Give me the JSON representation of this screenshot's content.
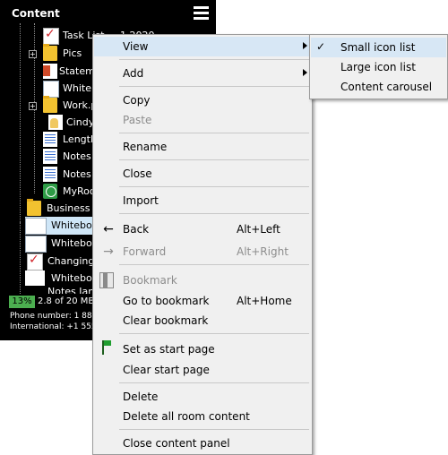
{
  "panel": {
    "title": "Content",
    "tree": [
      {
        "label": "Task List ... 1 2020",
        "icon": "checklist-icon"
      },
      {
        "label": "Pics",
        "icon": "folder-icon"
      },
      {
        "label": "Statem",
        "icon": "presentation-icon"
      },
      {
        "label": "Whiteb",
        "icon": "whiteboard-icon"
      },
      {
        "label": "Work.p",
        "icon": "folder-icon"
      },
      {
        "label": "Cindy",
        "icon": "person-icon"
      },
      {
        "label": "Length",
        "icon": "document-icon"
      },
      {
        "label": "Notes",
        "icon": "notes-icon"
      },
      {
        "label": "Notes",
        "icon": "notes-icon"
      },
      {
        "label": "MyRoo",
        "icon": "globe-icon"
      },
      {
        "label": "Business",
        "icon": "folder-icon"
      },
      {
        "label": "Whitebo",
        "icon": "whiteboard-icon"
      },
      {
        "label": "Whitebo",
        "icon": "whiteboard-icon"
      },
      {
        "label": "Changing",
        "icon": "checklist-icon"
      },
      {
        "label": "Whitebo",
        "icon": "whiteboard-icon"
      },
      {
        "label": "Notes Jan",
        "icon": "notes-icon"
      }
    ],
    "usage_percent_label": "13%",
    "usage_percent": 13,
    "usage_size": "2.8 of 20 MB",
    "phone": "Phone number: 1 888",
    "international": "International:  +1 555"
  },
  "menu": {
    "view": "View",
    "add": "Add",
    "copy": "Copy",
    "paste": "Paste",
    "rename": "Rename",
    "close": "Close",
    "import": "Import",
    "back": "Back",
    "back_shortcut": "Alt+Left",
    "forward": "Forward",
    "forward_shortcut": "Alt+Right",
    "bookmark": "Bookmark",
    "go_to_bookmark": "Go to bookmark",
    "go_to_bookmark_shortcut": "Alt+Home",
    "clear_bookmark": "Clear bookmark",
    "set_start_page": "Set as start page",
    "clear_start_page": "Clear start page",
    "delete": "Delete",
    "delete_all": "Delete all room content",
    "close_panel": "Close content panel"
  },
  "submenu": {
    "small_icon_list": "Small icon list",
    "large_icon_list": "Large icon list",
    "content_carousel": "Content carousel",
    "checked": "small_icon_list"
  },
  "colors": {
    "panel_bg": "#000000",
    "menu_bg": "#f0f0f0",
    "hover": "#d7e7f5",
    "usage_bar": "#4caf50",
    "selected_row": "#cfe6f7"
  }
}
